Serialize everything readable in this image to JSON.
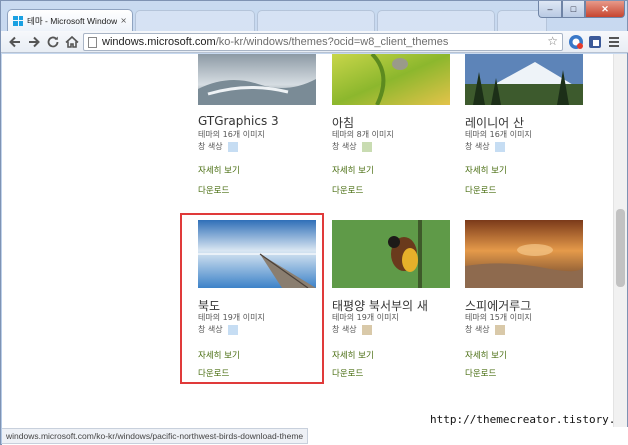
{
  "browser": {
    "tab_title": "테마 - Microsoft Window",
    "tab_close_glyph": "×",
    "url_host": "windows.microsoft.com",
    "url_path": "/ko-kr/windows/themes?ocid=w8_client_themes",
    "status_url": "windows.microsoft.com/ko-kr/windows/pacific-northwest-birds-download-theme",
    "window_controls": {
      "minimize": "–",
      "maximize": "□",
      "close": "✕"
    }
  },
  "themes": [
    {
      "name": "GTGraphics 3",
      "count": "테마의 16개 이미지",
      "color_label": "창 색상",
      "swatch": "#c6ddf3",
      "details": "자세히 보기",
      "download": "다운로드"
    },
    {
      "name": "아침",
      "count": "테마의 8개 이미지",
      "color_label": "창 색상",
      "swatch": "#c9dcb2",
      "details": "자세히 보기",
      "download": "다운로드"
    },
    {
      "name": "레이니어 산",
      "count": "테마의 16개 이미지",
      "color_label": "창 색상",
      "swatch": "#c6ddf3",
      "details": "자세히 보기",
      "download": "다운로드"
    },
    {
      "name": "북도",
      "count": "테마의 19개 이미지",
      "color_label": "창 색상",
      "swatch": "#c6ddf3",
      "details": "자세히 보기",
      "download": "다운로드"
    },
    {
      "name": "태평양 북서부의 새",
      "count": "테마의 19개 이미지",
      "color_label": "창 색상",
      "swatch": "#d9c9a9",
      "details": "자세히 보기",
      "download": "다운로드"
    },
    {
      "name": "스피에거루그",
      "count": "테마의 15개 이미지",
      "color_label": "창 색상",
      "swatch": "#d9c9a9",
      "details": "자세히 보기",
      "download": "다운로드"
    }
  ],
  "watermark": "http://themecreator.tistory.com",
  "colors": {
    "link": "#4a6e12",
    "highlight": "#e03a3a"
  }
}
